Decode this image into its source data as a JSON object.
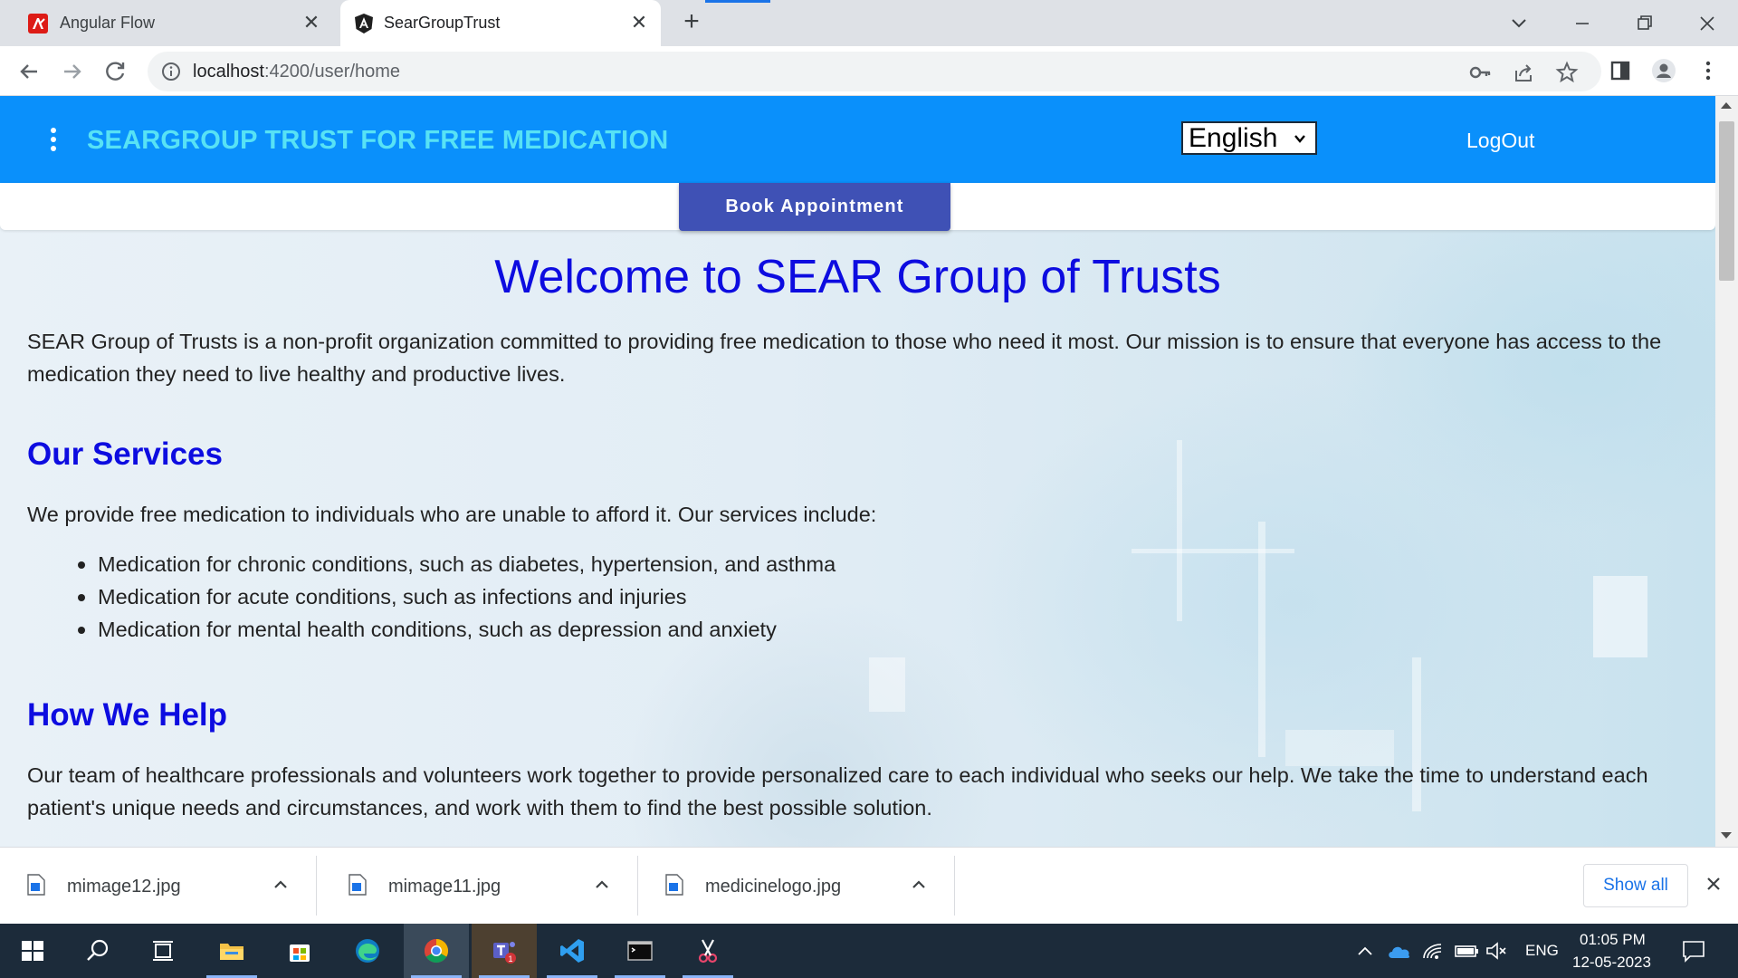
{
  "browser": {
    "tabs": [
      {
        "title": "Angular Flow",
        "favicon": "angular-flow-icon"
      },
      {
        "title": "SearGroupTrust",
        "favicon": "angular-icon"
      }
    ],
    "close_glyph": "✕",
    "new_tab_glyph": "+",
    "url_host": "localhost",
    "url_path": ":4200/user/home"
  },
  "header": {
    "brand": "SEARGROUP TRUST FOR FREE MEDICATION",
    "language": "English",
    "logout_label": "LogOut"
  },
  "book_button": "Book Appointment",
  "content": {
    "title": "Welcome to SEAR Group of Trusts",
    "intro": "SEAR Group of Trusts is a non-profit organization committed to providing free medication to those who need it most. Our mission is to ensure that everyone has access to the medication they need to live healthy and productive lives.",
    "services_heading": "Our Services",
    "services_text": "We provide free medication to individuals who are unable to afford it. Our services include:",
    "services": [
      "Medication for chronic conditions, such as diabetes, hypertension, and asthma",
      "Medication for acute conditions, such as infections and injuries",
      "Medication for mental health conditions, such as depression and anxiety"
    ],
    "help_heading": "How We Help",
    "help_text": "Our team of healthcare professionals and volunteers work together to provide personalized care to each individual who seeks our help. We take the time to understand each patient's unique needs and circumstances, and work with them to find the best possible solution."
  },
  "downloads": {
    "items": [
      "mimage12.jpg",
      "mimage11.jpg",
      "medicinelogo.jpg"
    ],
    "show_all": "Show all"
  },
  "taskbar": {
    "language": "ENG",
    "time": "01:05 PM",
    "date": "12-05-2023",
    "teams_badge": "1"
  },
  "colors": {
    "header_bg": "#0a90fb",
    "brand_text": "#57e2f5",
    "heading_blue": "#0d0ce0",
    "button_indigo": "#3f51b5"
  }
}
